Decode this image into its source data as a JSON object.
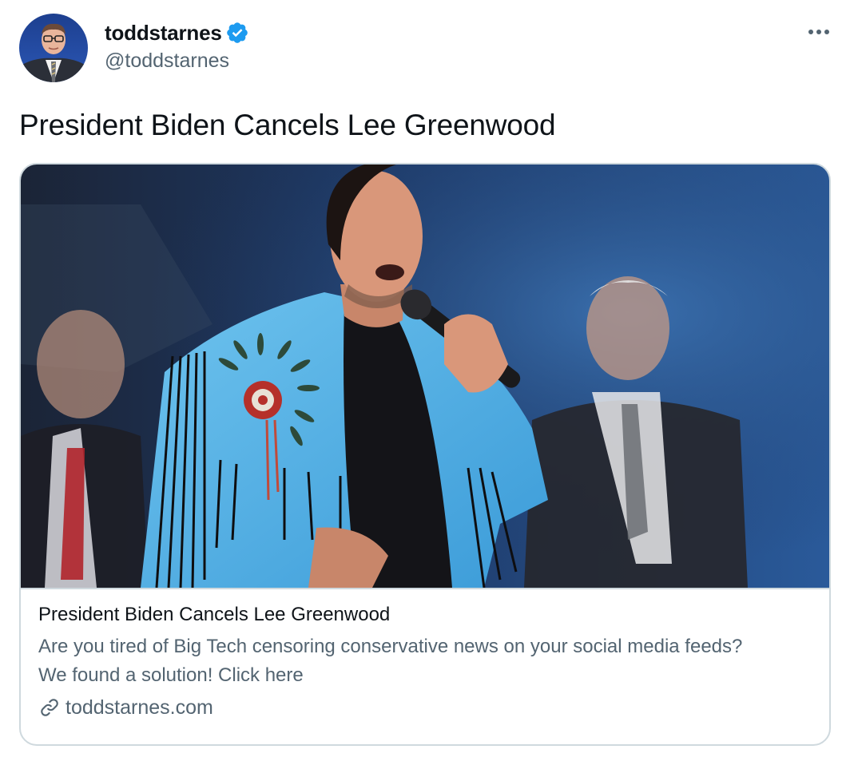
{
  "author": {
    "display_name": "toddstarnes",
    "handle": "@toddstarnes",
    "verified": true,
    "avatar_icon": "profile-photo"
  },
  "tweet": {
    "text": "President Biden Cancels Lee Greenwood"
  },
  "card": {
    "image_icon": "singer-photo",
    "title": "President Biden Cancels Lee Greenwood",
    "description": "Are you tired of Big Tech censoring conservative news on your social media feeds? We found a solution! Click here",
    "domain": "toddstarnes.com",
    "domain_icon": "link-icon"
  },
  "menu_icon": "more-dots-icon",
  "colors": {
    "text_primary": "#0f1419",
    "text_secondary": "#536471",
    "verified_blue": "#1d9bf0",
    "border": "#cfd9de"
  }
}
